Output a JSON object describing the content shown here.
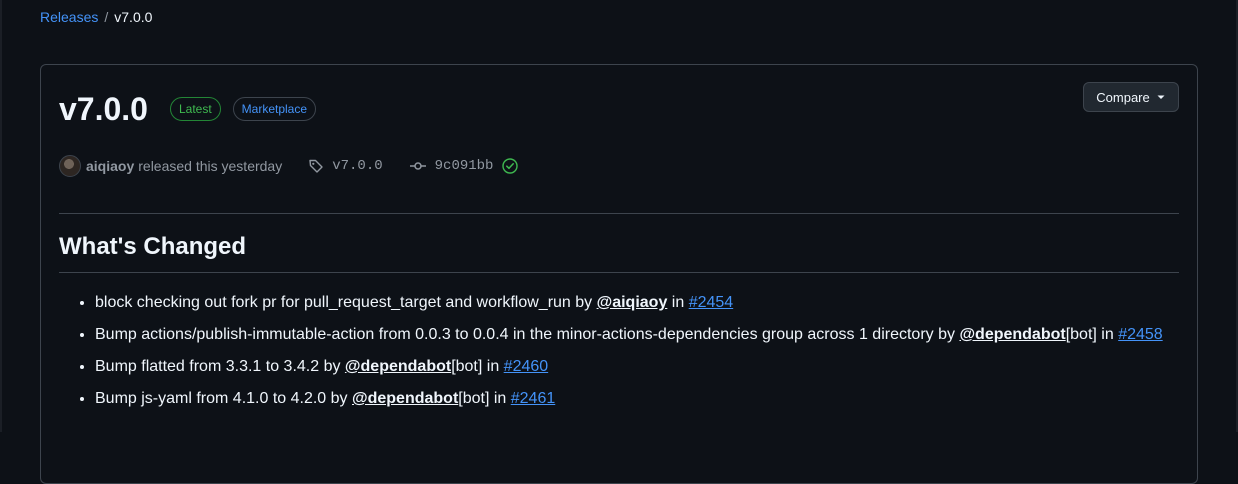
{
  "breadcrumb": {
    "link": "Releases",
    "separator": "/",
    "current": "v7.0.0"
  },
  "release": {
    "title": "v7.0.0",
    "badge_latest": "Latest",
    "badge_marketplace": "Marketplace",
    "compare_label": "Compare",
    "author": "aiqiaoy",
    "released_text": "released this yesterday",
    "tag": "v7.0.0",
    "commit": "9c091bb"
  },
  "notes": {
    "heading": "What's Changed",
    "items": [
      {
        "text": "block checking out fork pr for pull_request_target and workflow_run by ",
        "mention": "@aiqiaoy",
        "suffix": "",
        "in": " in ",
        "pr": "#2454"
      },
      {
        "text": "Bump actions/publish-immutable-action from 0.0.3 to 0.0.4 in the minor-actions-dependencies group across 1 directory by ",
        "mention": "@dependabot",
        "suffix": "[bot]",
        "in": " in ",
        "pr": "#2458"
      },
      {
        "text": "Bump flatted from 3.3.1 to 3.4.2 by ",
        "mention": "@dependabot",
        "suffix": "[bot]",
        "in": " in ",
        "pr": "#2460"
      },
      {
        "text": "Bump js-yaml from 4.1.0 to 4.2.0 by ",
        "mention": "@dependabot",
        "suffix": "[bot]",
        "in": " in ",
        "pr": "#2461"
      }
    ]
  },
  "colors": {
    "background": "#0d1117",
    "link": "#4493f8",
    "latest": "#3fb950",
    "border": "#3d444d"
  },
  "icons": [
    "tag-icon",
    "commit-icon",
    "verified-check-icon",
    "caret-down-icon"
  ]
}
